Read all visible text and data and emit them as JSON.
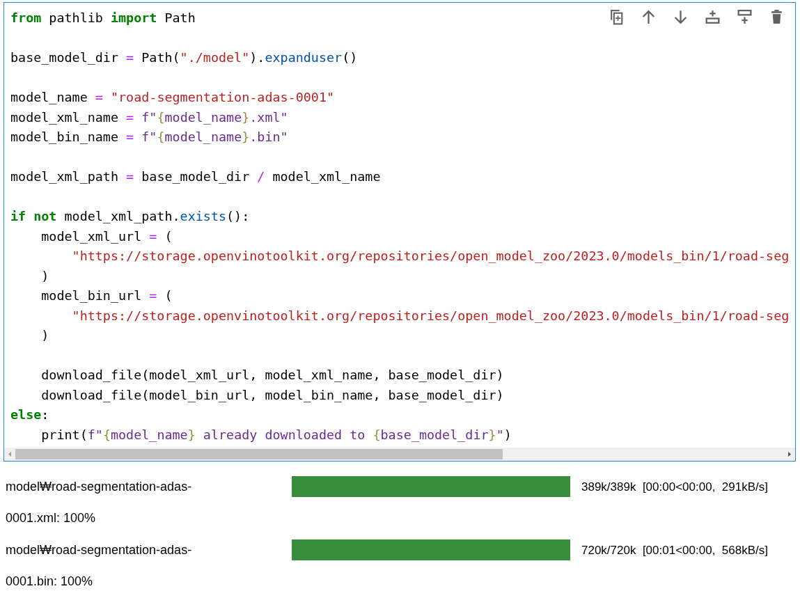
{
  "code_cell": {
    "blocks": [
      [
        {
          "tokens": [
            {
              "kind": "keyword",
              "text": "from"
            },
            {
              "kind": "name",
              "text": " pathlib "
            },
            {
              "kind": "keyword",
              "text": "import"
            },
            {
              "kind": "name",
              "text": " Path"
            }
          ]
        }
      ],
      [
        {
          "tokens": [
            {
              "kind": "name",
              "text": "base_model_dir "
            },
            {
              "kind": "operator",
              "text": "="
            },
            {
              "kind": "name",
              "text": " Path("
            },
            {
              "kind": "string",
              "text": "\"./model\""
            },
            {
              "kind": "name",
              "text": ")."
            },
            {
              "kind": "method",
              "text": "expanduser"
            },
            {
              "kind": "name",
              "text": "()"
            }
          ]
        }
      ],
      [
        {
          "tokens": [
            {
              "kind": "name",
              "text": "model_name "
            },
            {
              "kind": "operator",
              "text": "= "
            },
            {
              "kind": "string",
              "text": "\"road-segmentation-adas-0001\""
            }
          ]
        },
        {
          "tokens": [
            {
              "kind": "name",
              "text": "model_xml_name "
            },
            {
              "kind": "operator",
              "text": "= "
            },
            {
              "kind": "fstring",
              "text": "f\""
            },
            {
              "kind": "brace",
              "text": "{"
            },
            {
              "kind": "fstring",
              "text": "model_name"
            },
            {
              "kind": "brace",
              "text": "}"
            },
            {
              "kind": "fstring",
              "text": ".xml\""
            }
          ]
        },
        {
          "tokens": [
            {
              "kind": "name",
              "text": "model_bin_name "
            },
            {
              "kind": "operator",
              "text": "= "
            },
            {
              "kind": "fstring",
              "text": "f\""
            },
            {
              "kind": "brace",
              "text": "{"
            },
            {
              "kind": "fstring",
              "text": "model_name"
            },
            {
              "kind": "brace",
              "text": "}"
            },
            {
              "kind": "fstring",
              "text": ".bin\""
            }
          ]
        }
      ],
      [
        {
          "tokens": [
            {
              "kind": "name",
              "text": "model_xml_path "
            },
            {
              "kind": "operator",
              "text": "="
            },
            {
              "kind": "name",
              "text": " base_model_dir "
            },
            {
              "kind": "operator",
              "text": "/"
            },
            {
              "kind": "name",
              "text": " model_xml_name"
            }
          ]
        }
      ],
      [
        {
          "tokens": [
            {
              "kind": "keyword",
              "text": "if not"
            },
            {
              "kind": "name",
              "text": " model_xml_path."
            },
            {
              "kind": "method",
              "text": "exists"
            },
            {
              "kind": "name",
              "text": "():"
            }
          ]
        },
        {
          "tokens": [
            {
              "kind": "name",
              "text": "    model_xml_url "
            },
            {
              "kind": "operator",
              "text": "="
            },
            {
              "kind": "name",
              "text": " ("
            }
          ]
        },
        {
          "tokens": [
            {
              "kind": "string",
              "text": "        \"https://storage.openvinotoolkit.org/repositories/open_model_zoo/2023.0/models_bin/1/road-seg"
            }
          ]
        },
        {
          "tokens": [
            {
              "kind": "name",
              "text": "    )"
            }
          ]
        },
        {
          "tokens": [
            {
              "kind": "name",
              "text": "    model_bin_url "
            },
            {
              "kind": "operator",
              "text": "="
            },
            {
              "kind": "name",
              "text": " ("
            }
          ]
        },
        {
          "tokens": [
            {
              "kind": "string",
              "text": "        \"https://storage.openvinotoolkit.org/repositories/open_model_zoo/2023.0/models_bin/1/road-seg"
            }
          ]
        },
        {
          "tokens": [
            {
              "kind": "name",
              "text": "    )"
            }
          ]
        }
      ],
      [
        {
          "tokens": [
            {
              "kind": "name",
              "text": "    download_file(model_xml_url, model_xml_name, base_model_dir)"
            }
          ]
        },
        {
          "tokens": [
            {
              "kind": "name",
              "text": "    download_file(model_bin_url, model_bin_name, base_model_dir)"
            }
          ]
        },
        {
          "tokens": [
            {
              "kind": "keyword",
              "text": "else"
            },
            {
              "kind": "name",
              "text": ":"
            }
          ]
        },
        {
          "tokens": [
            {
              "kind": "name",
              "text": "    print("
            },
            {
              "kind": "fstring",
              "text": "f\""
            },
            {
              "kind": "brace",
              "text": "{"
            },
            {
              "kind": "fstring",
              "text": "model_name"
            },
            {
              "kind": "brace",
              "text": "}"
            },
            {
              "kind": "fstring",
              "text": " already downloaded to "
            },
            {
              "kind": "brace",
              "text": "{"
            },
            {
              "kind": "fstring",
              "text": "base_model_dir"
            },
            {
              "kind": "brace",
              "text": "}"
            },
            {
              "kind": "fstring",
              "text": "\""
            },
            {
              "kind": "name",
              "text": ")"
            }
          ]
        }
      ]
    ]
  },
  "toolbar": [
    {
      "kind": "duplicate"
    },
    {
      "kind": "up"
    },
    {
      "kind": "down"
    },
    {
      "kind": "insert-above"
    },
    {
      "kind": "insert-below"
    },
    {
      "kind": "delete"
    }
  ],
  "outputs": [
    {
      "label": "model₩road-segmentation-adas-0001.xml:  100%",
      "level": 1,
      "stats": "389k/389k  [00:00<00:00,  291kB/s]"
    },
    {
      "label": "model₩road-segmentation-adas-0001.bin:  100%",
      "level": 1,
      "stats": "720k/720k  [00:01<00:00,  568kB/s]"
    }
  ]
}
